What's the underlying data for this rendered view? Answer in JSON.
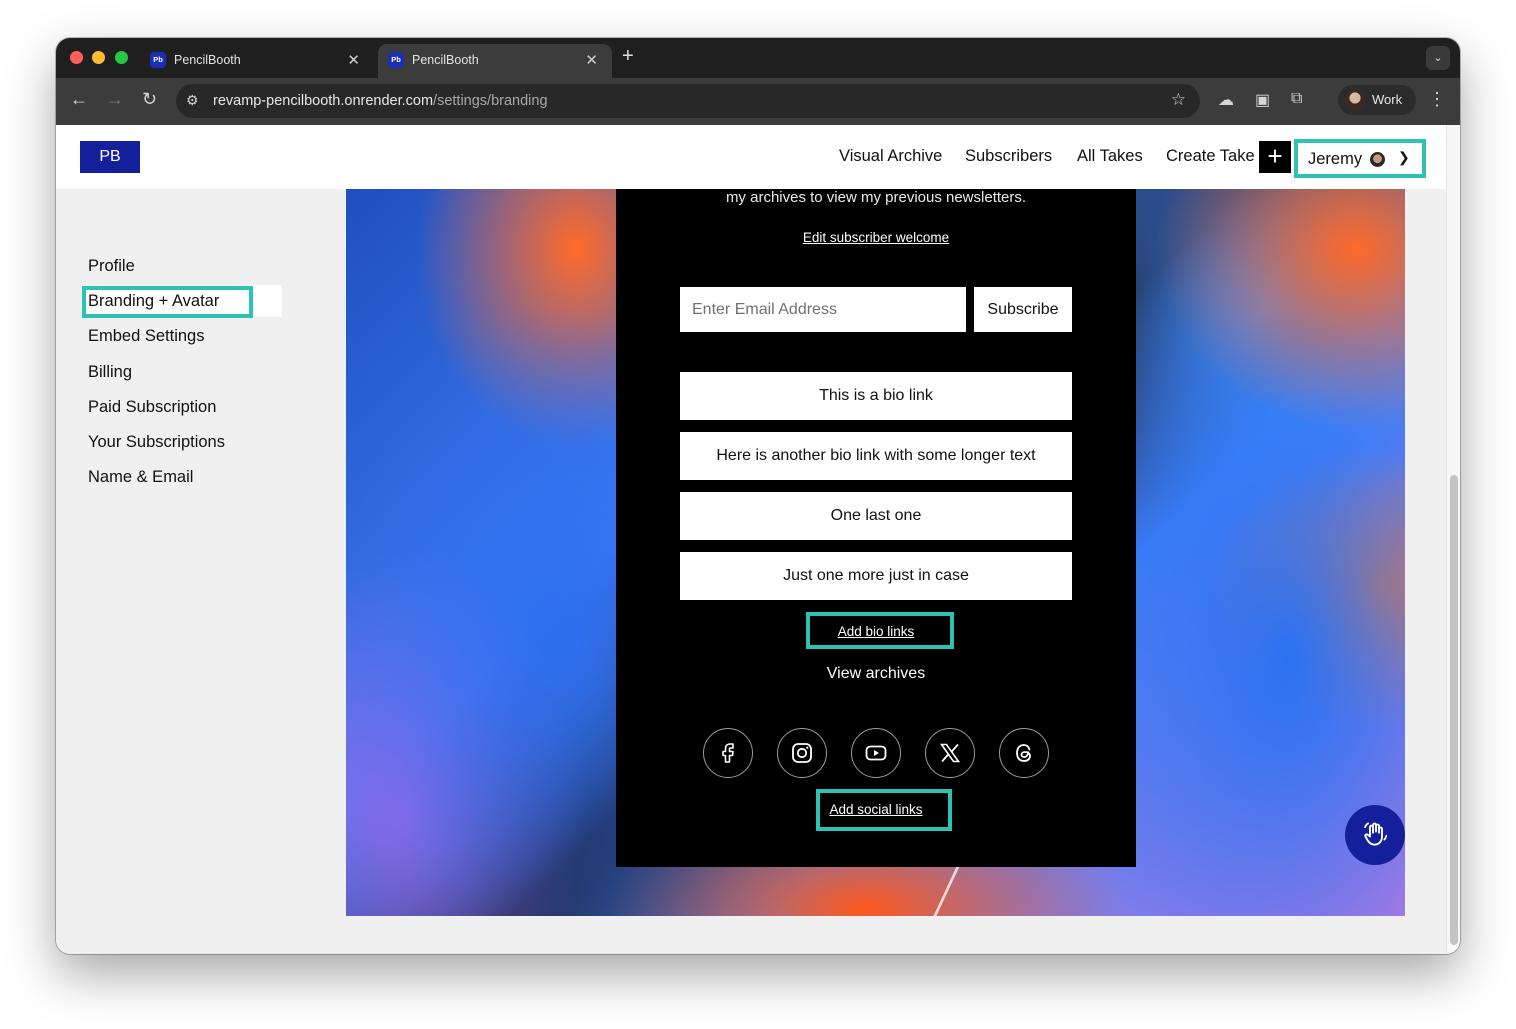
{
  "browser": {
    "tabs": [
      {
        "favicon": "Pb",
        "title": "PencilBooth"
      },
      {
        "favicon": "Pb",
        "title": "PencilBooth"
      }
    ],
    "url_host": "revamp-pencilbooth.onrender.com",
    "url_path": "/settings/branding",
    "profile_name": "Work"
  },
  "site": {
    "logo": "PB",
    "nav": [
      "Visual Archive",
      "Subscribers",
      "All Takes",
      "Create Take"
    ],
    "plus": "+",
    "user_name": "Jeremy"
  },
  "sidebar": {
    "items": [
      "Profile",
      "Branding + Avatar",
      "Embed Settings",
      "Billing",
      "Paid Subscription",
      "Your Subscriptions",
      "Name & Email"
    ],
    "active": "Branding + Avatar"
  },
  "preview": {
    "intro_text": "my archives to view my previous newsletters.",
    "edit_welcome": "Edit subscriber welcome",
    "email_placeholder": "Enter Email Address",
    "subscribe_label": "Subscribe",
    "bio_links": [
      "This is a bio link",
      "Here is another bio link with some longer text",
      "One last one",
      "Just one more just in case"
    ],
    "add_bio_links": "Add bio links",
    "view_archives": "View archives",
    "social_icons": [
      "facebook-icon",
      "instagram-icon",
      "youtube-icon",
      "x-icon",
      "threads-icon"
    ],
    "add_social_links": "Add social links"
  },
  "colors": {
    "brand": "#14209b",
    "highlight": "#2cc3b4"
  }
}
